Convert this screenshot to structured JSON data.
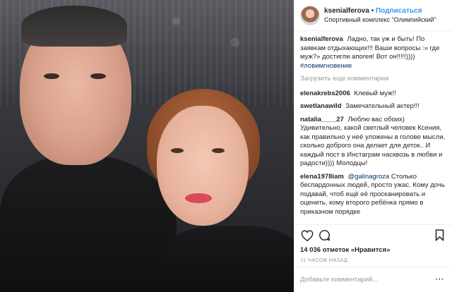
{
  "header": {
    "username": "ksenialferova",
    "separator": "•",
    "follow_label": "Подписаться",
    "location": "Спортивный комплекс \"Олимпийский\""
  },
  "caption": {
    "username": "ksenialferova",
    "text": "Ладно, так уж и быть! По заявкам отдыхающих!!! Ваши вопросы :» где муж?» достигли апогея! Вот он!!!!!))))",
    "hashtag": "#ловимгновение"
  },
  "load_more_label": "Загрузить еще комментарии",
  "comments": [
    {
      "username": "elenakrebs2006",
      "text": "Клевый муж!!"
    },
    {
      "username": "swetlanawild",
      "text": "Замечательный актер!!!"
    },
    {
      "username": "natalia____27",
      "text": "Люблю вас обоих) Удивительно, какой светлый человек Ксения, как правильно у неё уложены в голове мысли, сколько доброго она делает для деток.. И каждый пост в Инстаграм насквозь в любви и радости)))) Молодцы!"
    },
    {
      "username": "elena1978iam",
      "mention": "@galinagroza",
      "text": "Столько беспардонных людей, просто ужас. Кому дочь подавай, чтоб ещё её просканировать и оценить, кому второго ребёнка прямо в приказном порядке"
    }
  ],
  "likes_text": "14 036 отметок «Нравится»",
  "time_text": "11 часов назад",
  "comment_input": {
    "placeholder": "Добавьте комментарий..."
  },
  "more_label": "···",
  "icons": {
    "like": "heart-icon",
    "comment": "comment-icon",
    "save": "bookmark-icon"
  },
  "colors": {
    "follow": "#3897f0",
    "hashtag": "#003569",
    "muted": "#999999"
  }
}
